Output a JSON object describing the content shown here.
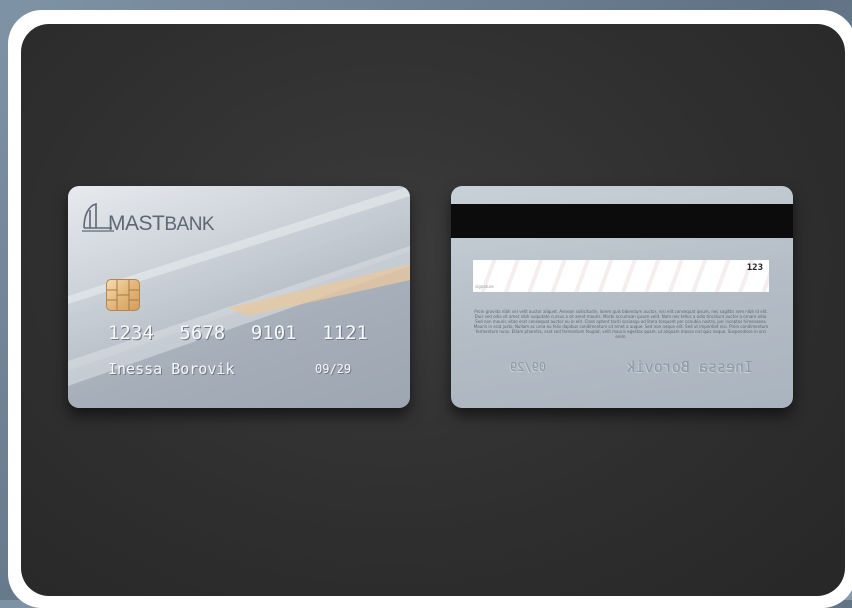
{
  "card_front": {
    "brand": "MAST",
    "brand_suffix": "BANK",
    "number_groups": [
      "1234",
      "5678",
      "9101",
      "1121"
    ],
    "holder": "Inessa Borovik",
    "expiry": "09/29"
  },
  "card_back": {
    "cvv": "123",
    "signature_label": "signature",
    "legal_text": "Proin gravida nibh vel velit auctor aliquet. Aenean sollicitudin, lorem quis bibendum auctor, nisi elit consequat ipsum, nec sagittis sem nibh id elit. Duis sed odio sit amet nibh vulputate cursus a sit amet mauris. Morbi accumsan ipsum velit. Nam nec tellus a odio tincidunt auctor a ornare odio. Sed non mauris vitae erat consequat auctor eu in elit. Class aptent taciti sociosqu ad litora torquent per conubia nostra, per inceptos himenaeos. Mauris in erat justo. Nullam ac urna eu felis dapibus condimentum sit amet a augue. Sed non neque elit. Sed ut imperdiet nisi. Proin condimentum fermentum nunc. Etiam pharetra, erat sed fermentum feugiat, velit mauris egestas quam, ut aliquam massa nisl quis neque. Suspendisse in orci enim.",
    "mirrored_holder": "Inessa Borovik",
    "mirrored_expiry": "09/29"
  },
  "colors": {
    "background": "#2f2f2f",
    "frame": "#ffffff",
    "card_silver": "#c8ced5",
    "accent_gold": "#e2b77c",
    "mag_stripe": "#0c0c0c"
  }
}
